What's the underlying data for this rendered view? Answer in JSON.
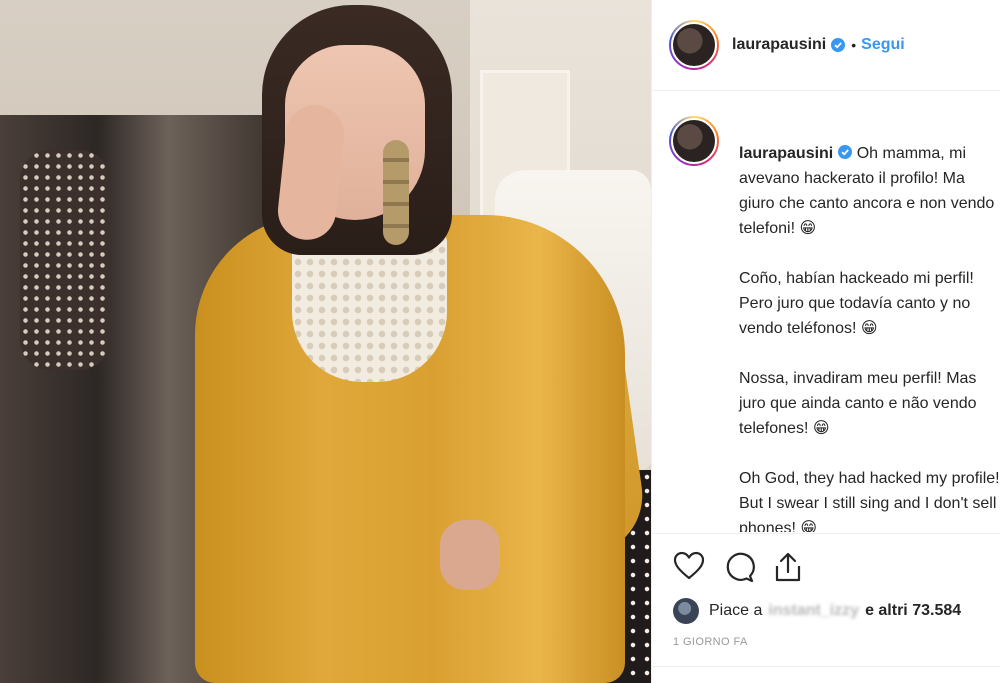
{
  "post": {
    "username": "laurapausini",
    "follow_label": "Segui",
    "separator": "•",
    "caption_paragraphs": [
      "Oh mamma, mi avevano hackerato il profilo! Ma giuro che canto ancora e non vendo telefoni! 😁",
      "Coño, habían hackeado mi perfil! Pero juro que todavía canto y no vendo teléfonos! 😁",
      "Nossa, invadiram meu perfil! Mas juro que ainda canto e não vendo telefones! 😁",
      "Oh God, they had hacked my profile! But I swear I still sing and I don't sell phones! 😁"
    ],
    "likes_prefix": "Piace a",
    "likes_user": "instant_izzy",
    "likes_suffix": "e altri 73.584",
    "timestamp": "1 GIORNO FA"
  },
  "icons": {
    "like": "heart-icon",
    "comment": "comment-icon",
    "share": "share-icon",
    "verified": "verified-badge-icon"
  },
  "colors": {
    "link_blue": "#3897f0",
    "verified_blue": "#3897f0",
    "meta_gray": "#999999"
  }
}
